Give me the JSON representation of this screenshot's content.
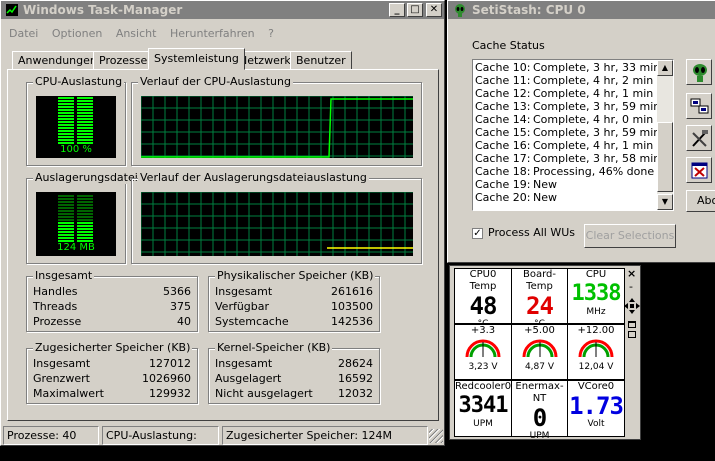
{
  "taskmgr": {
    "title": "Windows Task-Manager",
    "menu": [
      "Datei",
      "Optionen",
      "Ansicht",
      "Herunterfahren",
      "?"
    ],
    "tabs": [
      "Anwendungen",
      "Prozesse",
      "Systemleistung",
      "Netzwerk",
      "Benutzer"
    ],
    "active_tab": "Systemleistung",
    "cpu_usage": {
      "label": "CPU-Auslastung",
      "value": "100 %",
      "percent": 100
    },
    "cpu_history": {
      "label": "Verlauf der CPU-Auslastung"
    },
    "pagefile": {
      "label": "Auslagerungsdatei",
      "value": "124 MB",
      "fraction": 0.45
    },
    "pagefile_history": {
      "label": "Verlauf der Auslagerungsdateiauslastung"
    },
    "totals": {
      "label": "Insgesamt",
      "rows": [
        {
          "k": "Handles",
          "v": "5366"
        },
        {
          "k": "Threads",
          "v": "375"
        },
        {
          "k": "Prozesse",
          "v": "40"
        }
      ]
    },
    "physical": {
      "label": "Physikalischer Speicher (KB)",
      "rows": [
        {
          "k": "Insgesamt",
          "v": "261616"
        },
        {
          "k": "Verfügbar",
          "v": "103500"
        },
        {
          "k": "Systemcache",
          "v": "142536"
        }
      ]
    },
    "commit": {
      "label": "Zugesicherter Speicher (KB)",
      "rows": [
        {
          "k": "Insgesamt",
          "v": "127012"
        },
        {
          "k": "Grenzwert",
          "v": "1026960"
        },
        {
          "k": "Maximalwert",
          "v": "129932"
        }
      ]
    },
    "kernel": {
      "label": "Kernel-Speicher (KB)",
      "rows": [
        {
          "k": "Insgesamt",
          "v": "28624"
        },
        {
          "k": "Ausgelagert",
          "v": "16592"
        },
        {
          "k": "Nicht ausgelagert",
          "v": "12032"
        }
      ]
    },
    "status": {
      "processes": "Prozesse: 40",
      "cpu": "CPU-Auslastung: 100%",
      "commit": "Zugesicherter Speicher: 124M"
    }
  },
  "setistash": {
    "title": "SetiStash: CPU 0",
    "cache_status_label": "Cache Status",
    "caches": [
      {
        "name": "Cache 10:",
        "status": "Complete, 3 hr, 33 min"
      },
      {
        "name": "Cache 11:",
        "status": "Complete, 4 hr, 2 min"
      },
      {
        "name": "Cache 12:",
        "status": "Complete, 4 hr, 1 min"
      },
      {
        "name": "Cache 13:",
        "status": "Complete, 3 hr, 59 min"
      },
      {
        "name": "Cache 14:",
        "status": "Complete, 4 hr, 0 min"
      },
      {
        "name": "Cache 15:",
        "status": "Complete, 3 hr, 59 min"
      },
      {
        "name": "Cache 16:",
        "status": "Complete, 4 hr, 1 min"
      },
      {
        "name": "Cache 17:",
        "status": "Complete, 3 hr, 58 min"
      },
      {
        "name": "Cache 18:",
        "status": "Processing, 46% done"
      },
      {
        "name": "Cache 19:",
        "status": "New"
      },
      {
        "name": "Cache 20:",
        "status": "New"
      }
    ],
    "process_all_label": "Process All WUs",
    "process_all_checked": true,
    "clear_label": "Clear Selections",
    "side_button_cut": "Abo"
  },
  "monitor": {
    "top": [
      {
        "label": "CPU0 Temp",
        "value": "48",
        "unit": "°C",
        "color": "#000000"
      },
      {
        "label": "Board-Temp",
        "value": "24",
        "unit": "°C",
        "color": "#e00000"
      },
      {
        "label": "CPU",
        "value": "1338",
        "unit": "MHz",
        "color": "#00c000"
      }
    ],
    "volts": [
      {
        "label": "+3.3",
        "value": "3,23",
        "unit": "V"
      },
      {
        "label": "+5.00",
        "value": "4,87",
        "unit": "V"
      },
      {
        "label": "+12.00",
        "value": "12,04",
        "unit": "V"
      }
    ],
    "bottom": [
      {
        "label": "Redcooler0",
        "value": "3341",
        "unit": "UPM",
        "color": "#000000"
      },
      {
        "label": "Enermax-NT",
        "value": "0",
        "unit": "UPM",
        "color": "#000000"
      },
      {
        "label": "VCore0",
        "value": "1.73",
        "unit": "Volt",
        "color": "#0000e0"
      }
    ],
    "controls": {
      "close": "×",
      "minus": "-"
    }
  }
}
